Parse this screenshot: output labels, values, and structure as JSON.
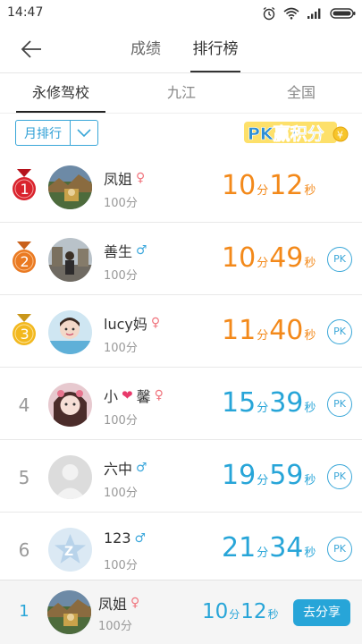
{
  "status_bar": {
    "time": "14:47"
  },
  "nav": {
    "tabs": [
      "成绩",
      "排行榜"
    ]
  },
  "subtabs": [
    "永修驾校",
    "九江",
    "全国"
  ],
  "filter": {
    "period": "月排行"
  },
  "pk_banner": {
    "text": "PK赢积分"
  },
  "ranking": [
    {
      "rank": "1",
      "name": "凤姐",
      "gender": "female",
      "score": "100分",
      "minutes": "10",
      "seconds": "12",
      "min_unit": "分",
      "sec_unit": "秒",
      "pk": "",
      "color": "#f3891a",
      "avatar": "scenery"
    },
    {
      "rank": "2",
      "name": "善生",
      "gender": "male",
      "score": "100分",
      "minutes": "10",
      "seconds": "49",
      "min_unit": "分",
      "sec_unit": "秒",
      "pk": "PK",
      "color": "#f3891a",
      "avatar": "street"
    },
    {
      "rank": "3",
      "name": "lucy妈",
      "gender": "female",
      "score": "100分",
      "minutes": "11",
      "seconds": "40",
      "min_unit": "分",
      "sec_unit": "秒",
      "pk": "PK",
      "color": "#f3891a",
      "avatar": "child"
    },
    {
      "rank": "4",
      "name_pre": "小",
      "name_post": "馨",
      "gender": "female",
      "score": "100分",
      "minutes": "15",
      "seconds": "39",
      "min_unit": "分",
      "sec_unit": "秒",
      "pk": "PK",
      "color": "#27a5d8",
      "avatar": "girl"
    },
    {
      "rank": "5",
      "name": "六中",
      "gender": "male",
      "score": "100分",
      "minutes": "19",
      "seconds": "59",
      "min_unit": "分",
      "sec_unit": "秒",
      "pk": "PK",
      "color": "#27a5d8",
      "avatar": "default"
    },
    {
      "rank": "6",
      "name": "123",
      "gender": "male",
      "score": "100分",
      "minutes": "21",
      "seconds": "34",
      "min_unit": "分",
      "sec_unit": "秒",
      "pk": "PK",
      "color": "#27a5d8",
      "avatar": "star"
    }
  ],
  "my_rank": {
    "rank": "1",
    "name": "凤姐",
    "score": "100分",
    "minutes": "10",
    "seconds": "12",
    "min_unit": "分",
    "sec_unit": "秒",
    "share_label": "去分享"
  },
  "icons": {
    "female": "♀",
    "male": "♂",
    "heart": "❤"
  },
  "colors": {
    "accent_blue": "#27a5d8",
    "accent_orange": "#f3891a",
    "gold": "#f2b81e",
    "silver_bronze": "#e67e22",
    "red": "#d9232d"
  }
}
